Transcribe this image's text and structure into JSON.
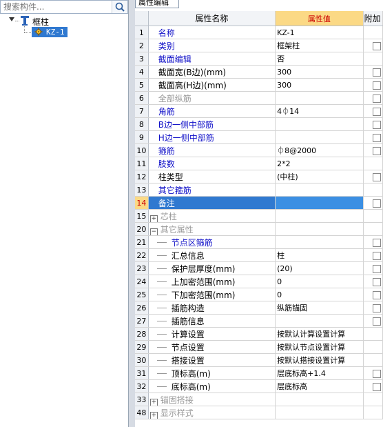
{
  "left_panel": {
    "search_placeholder": "搜索构件...",
    "tree": {
      "root": "框柱",
      "child": "KZ-1"
    }
  },
  "right_panel": {
    "tab_label": "属性编辑",
    "columns": [
      "属性名称",
      "属性值",
      "附加"
    ],
    "rows": [
      {
        "num": "1",
        "name": "名称",
        "value": "KZ-1",
        "style": "blue",
        "checkbox": false
      },
      {
        "num": "2",
        "name": "类别",
        "value": "框架柱",
        "style": "blue",
        "checkbox": true
      },
      {
        "num": "3",
        "name": "截面编辑",
        "value": "否",
        "style": "blue",
        "checkbox": false
      },
      {
        "num": "4",
        "name": "截面宽(B边)(mm)",
        "value": "300",
        "style": "black",
        "checkbox": true
      },
      {
        "num": "5",
        "name": "截面高(H边)(mm)",
        "value": "300",
        "style": "black",
        "checkbox": true
      },
      {
        "num": "6",
        "name": "全部纵筋",
        "value": "",
        "style": "gray",
        "checkbox": true
      },
      {
        "num": "7",
        "name": "角筋",
        "value": "4⏀14",
        "style": "blue",
        "checkbox": true
      },
      {
        "num": "8",
        "name": "B边一侧中部筋",
        "value": "",
        "style": "blue",
        "checkbox": true
      },
      {
        "num": "9",
        "name": "H边一侧中部筋",
        "value": "",
        "style": "blue",
        "checkbox": true
      },
      {
        "num": "10",
        "name": "箍筋",
        "value": "⏀8@2000",
        "style": "blue",
        "checkbox": true
      },
      {
        "num": "11",
        "name": "肢数",
        "value": "2*2",
        "style": "blue",
        "checkbox": false
      },
      {
        "num": "12",
        "name": "柱类型",
        "value": "(中柱)",
        "style": "black",
        "checkbox": true
      },
      {
        "num": "13",
        "name": "其它箍筋",
        "value": "",
        "style": "blue",
        "checkbox": false
      },
      {
        "num": "14",
        "name": "备注",
        "value": "",
        "style": "selected",
        "checkbox": true
      },
      {
        "num": "15",
        "name": "芯柱",
        "value": "",
        "style": "group-collapsed",
        "checkbox": false
      },
      {
        "num": "20",
        "name": "其它属性",
        "value": "",
        "style": "group-expanded",
        "checkbox": false
      },
      {
        "num": "21",
        "name": "节点区箍筋",
        "value": "",
        "style": "sub-blue",
        "checkbox": true
      },
      {
        "num": "22",
        "name": "汇总信息",
        "value": "柱",
        "style": "sub",
        "checkbox": true
      },
      {
        "num": "23",
        "name": "保护层厚度(mm)",
        "value": "(20)",
        "style": "sub",
        "checkbox": true
      },
      {
        "num": "24",
        "name": "上加密范围(mm)",
        "value": "0",
        "style": "sub",
        "checkbox": true
      },
      {
        "num": "25",
        "name": "下加密范围(mm)",
        "value": "0",
        "style": "sub",
        "checkbox": true
      },
      {
        "num": "26",
        "name": "插筋构造",
        "value": "纵筋锚固",
        "style": "sub",
        "checkbox": true
      },
      {
        "num": "27",
        "name": "插筋信息",
        "value": "",
        "style": "sub",
        "checkbox": true
      },
      {
        "num": "28",
        "name": "计算设置",
        "value": "按默认计算设置计算",
        "style": "sub",
        "checkbox": false
      },
      {
        "num": "29",
        "name": "节点设置",
        "value": "按默认节点设置计算",
        "style": "sub",
        "checkbox": false
      },
      {
        "num": "30",
        "name": "搭接设置",
        "value": "按默认搭接设置计算",
        "style": "sub",
        "checkbox": false
      },
      {
        "num": "31",
        "name": "顶标高(m)",
        "value": "层底标高+1.4",
        "style": "sub",
        "checkbox": true
      },
      {
        "num": "32",
        "name": "底标高(m)",
        "value": "层底标高",
        "style": "sub",
        "checkbox": true
      },
      {
        "num": "33",
        "name": "锚固搭接",
        "value": "",
        "style": "group-collapsed",
        "checkbox": false
      },
      {
        "num": "48",
        "name": "显示样式",
        "value": "",
        "style": "group-collapsed",
        "checkbox": false
      }
    ]
  }
}
